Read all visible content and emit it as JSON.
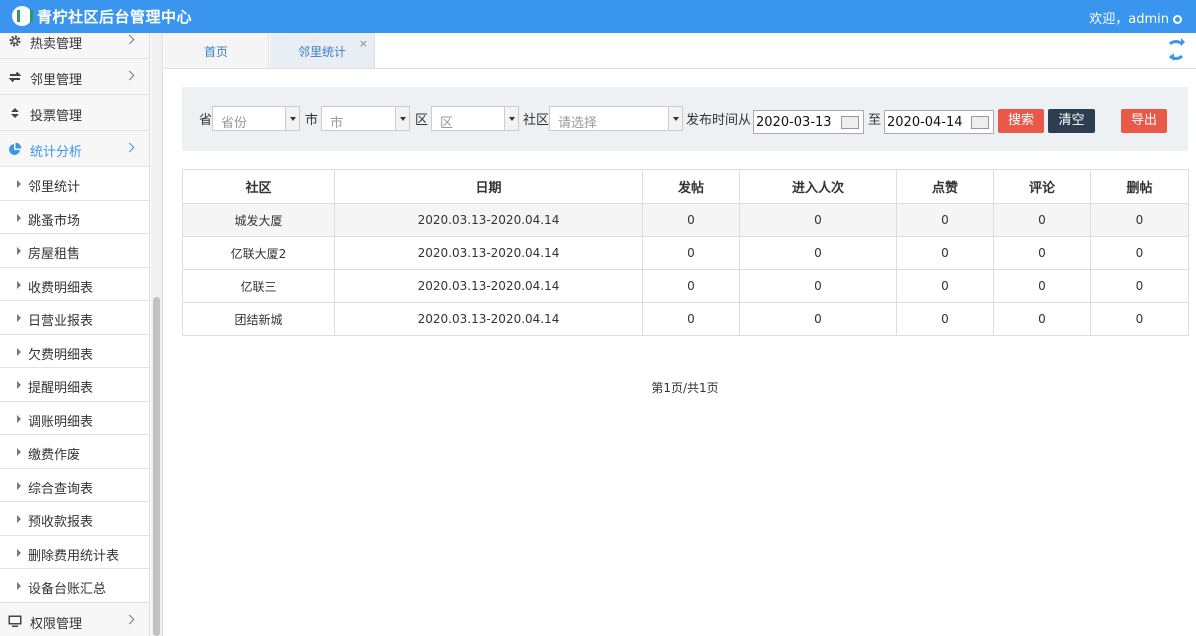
{
  "header": {
    "title": "青柠社区后台管理中心",
    "welcome": "欢迎，admin"
  },
  "sidebar": {
    "items_top": [
      {
        "label": "热卖管理",
        "icon": "gear-icon",
        "has_chevron": true
      },
      {
        "label": "邻里管理",
        "icon": "swap-icon",
        "has_chevron": true
      },
      {
        "label": "投票管理",
        "icon": "sort-icon",
        "has_chevron": false
      },
      {
        "label": "统计分析",
        "icon": "pie-chart-icon",
        "has_chevron": true,
        "active": true
      }
    ],
    "sub_items": [
      "邻里统计",
      "跳蚤市场",
      "房屋租售",
      "收费明细表",
      "日营业报表",
      "欠费明细表",
      "提醒明细表",
      "调账明细表",
      "缴费作废",
      "综合查询表",
      "预收款报表",
      "删除费用统计表",
      "设备台账汇总"
    ],
    "items_bottom": [
      {
        "label": "权限管理",
        "icon": "monitor-icon",
        "has_chevron": true
      }
    ]
  },
  "tabs": [
    {
      "label": "首页"
    },
    {
      "label": "邻里统计",
      "closable": true,
      "close": "×"
    }
  ],
  "filters": {
    "province_label": "省",
    "province_placeholder": "省份",
    "city_label": "市",
    "city_placeholder": "市",
    "district_label": "区",
    "district_placeholder": "区",
    "community_label": "社区",
    "community_placeholder": "请选择",
    "date_from_label": "发布时间从",
    "date_from": "2020-03-13",
    "date_to_label": "至",
    "date_to": "2020-04-14",
    "search_label": "搜索",
    "clear_label": "清空",
    "export_label": "导出"
  },
  "table": {
    "columns": [
      "社区",
      "日期",
      "发帖",
      "进入人次",
      "点赞",
      "评论",
      "删帖"
    ],
    "rows": [
      [
        "城发大厦",
        "2020.03.13-2020.04.14",
        "0",
        "0",
        "0",
        "0",
        "0"
      ],
      [
        "亿联大厦2",
        "2020.03.13-2020.04.14",
        "0",
        "0",
        "0",
        "0",
        "0"
      ],
      [
        "亿联三",
        "2020.03.13-2020.04.14",
        "0",
        "0",
        "0",
        "0",
        "0"
      ],
      [
        "团结新城",
        "2020.03.13-2020.04.14",
        "0",
        "0",
        "0",
        "0",
        "0"
      ]
    ]
  },
  "pager": {
    "text": "第1页/共1页"
  },
  "colors": {
    "header_bg": "#3a95ee",
    "danger": "#e8594a",
    "dark": "#2d3e50"
  }
}
